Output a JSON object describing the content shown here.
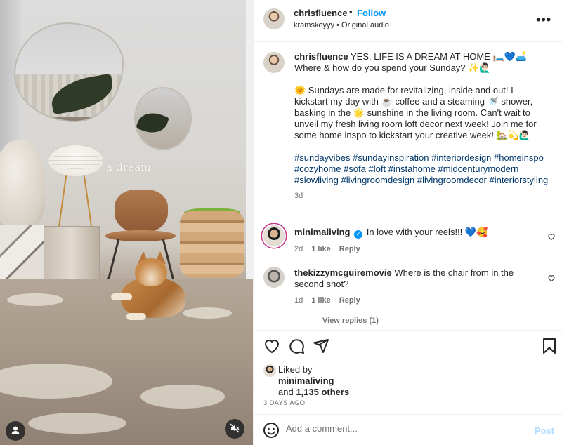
{
  "media": {
    "overlay_text": "a dream",
    "profile_icon": "person-icon",
    "mute_icon": "muted-speaker-icon"
  },
  "header": {
    "username": "chrisfluence",
    "separator": "•",
    "follow_label": "Follow",
    "subline": "kramskoyyy • Original audio",
    "more_label": "•••"
  },
  "caption": {
    "username": "chrisfluence",
    "line1": "YES, LIFE IS A DREAM AT HOME 🛏️💙🛋️ Where & how do you spend your Sunday? ✨🙋🏻‍♂️",
    "line2": "🌞 Sundays are made for revitalizing, inside and out! I kickstart my day with ☕ coffee and a steaming 🚿 shower, basking in the 🌟 sunshine in the living room. Can't wait to unveil my fresh living room loft decor next week! Join me for some home inspo to kickstart your creative week! 🏡💫🙋🏻‍♂️",
    "hashtags": "#sundayvibes #sundayinspiration #interiordesign #homeinspo #cozyhome #sofa #loft #instahome #midcenturymodern #slowliving #livingroomdesign #livingroomdecor #interiorstyling",
    "age": "3d"
  },
  "comments": [
    {
      "username": "minimaliving",
      "verified_mark": "✓",
      "text": "In love with your reels!!! 💙🥰",
      "age": "2d",
      "likes": "1 like",
      "reply": "Reply"
    },
    {
      "username": "thekizzymcguiremovie",
      "text": "Where is the chair from in the second shot?",
      "age": "1d",
      "likes": "1 like",
      "reply": "Reply",
      "view_replies": "View replies (1)"
    }
  ],
  "actions": {
    "liked_by_label": "Liked by",
    "liked_by_user": "minimaliving",
    "and_label": "and",
    "others": "1,135 others",
    "posted_ago": "3 DAYS AGO"
  },
  "add_comment": {
    "placeholder": "Add a comment...",
    "post_label": "Post"
  },
  "colors": {
    "accent": "#0095f6",
    "hashtag": "#00376b",
    "muted": "#737373",
    "post_disabled": "#b3dbff"
  }
}
